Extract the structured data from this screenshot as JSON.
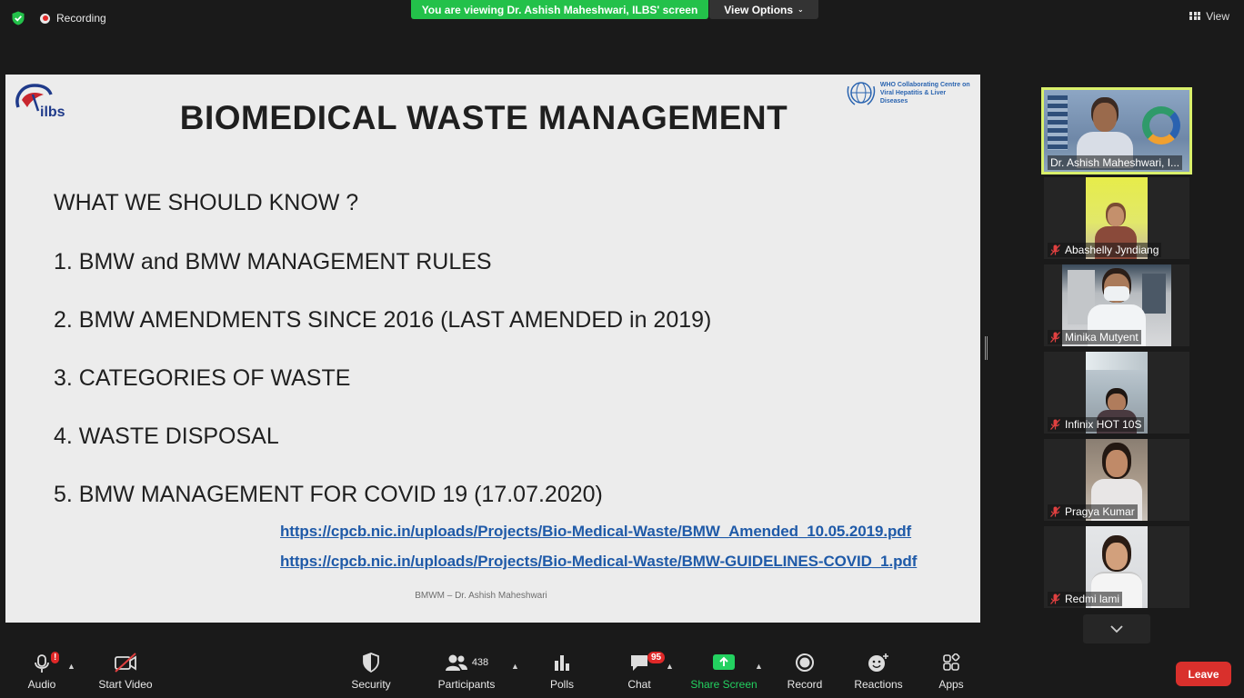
{
  "top_bar": {
    "recording_label": "Recording",
    "viewing_banner": "You are viewing Dr. Ashish Maheshwari, ILBS' screen",
    "view_options_label": "View Options",
    "view_label": "View"
  },
  "slide": {
    "logo_text": "ilbs",
    "who_line1": "WHO Collaborating Centre on",
    "who_line2": "Viral Hepatitis & Liver Diseases",
    "title": "BIOMEDICAL WASTE MANAGEMENT",
    "heading": "WHAT WE SHOULD KNOW ?",
    "items": [
      "1. BMW and BMW MANAGEMENT RULES",
      "2. BMW AMENDMENTS SINCE 2016 (LAST AMENDED in 2019)",
      "3. CATEGORIES OF WASTE",
      "4. WASTE DISPOSAL",
      "5. BMW MANAGEMENT FOR COVID 19 (17.07.2020)"
    ],
    "links": [
      "https://cpcb.nic.in/uploads/Projects/Bio-Medical-Waste/BMW_Amended_10.05.2019.pdf",
      "https://cpcb.nic.in/uploads/Projects/Bio-Medical-Waste/BMW-GUIDELINES-COVID_1.pdf"
    ],
    "footer": "BMWM – Dr. Ashish Maheshwari"
  },
  "participants": [
    {
      "name": "Dr. Ashish Maheshwari, I...",
      "muted": false,
      "active": true
    },
    {
      "name": "Abashelly Jyndiang",
      "muted": true
    },
    {
      "name": "Minika Mutyent",
      "muted": true
    },
    {
      "name": "Infinix HOT 10S",
      "muted": true
    },
    {
      "name": "Pragya Kumar",
      "muted": true
    },
    {
      "name": "Redmi lami",
      "muted": true
    }
  ],
  "toolbar": {
    "audio": "Audio",
    "audio_badge": "!",
    "start_video": "Start Video",
    "security": "Security",
    "participants": "Participants",
    "participants_count": "438",
    "polls": "Polls",
    "chat": "Chat",
    "chat_badge": "95",
    "share_screen": "Share Screen",
    "record": "Record",
    "reactions": "Reactions",
    "apps": "Apps",
    "leave": "Leave"
  },
  "colors": {
    "banner_green": "#23c14a",
    "share_green": "#23d160",
    "leave_red": "#d9302c",
    "active_speaker_border": "#d9f06b",
    "link_blue": "#1f5aa8"
  }
}
